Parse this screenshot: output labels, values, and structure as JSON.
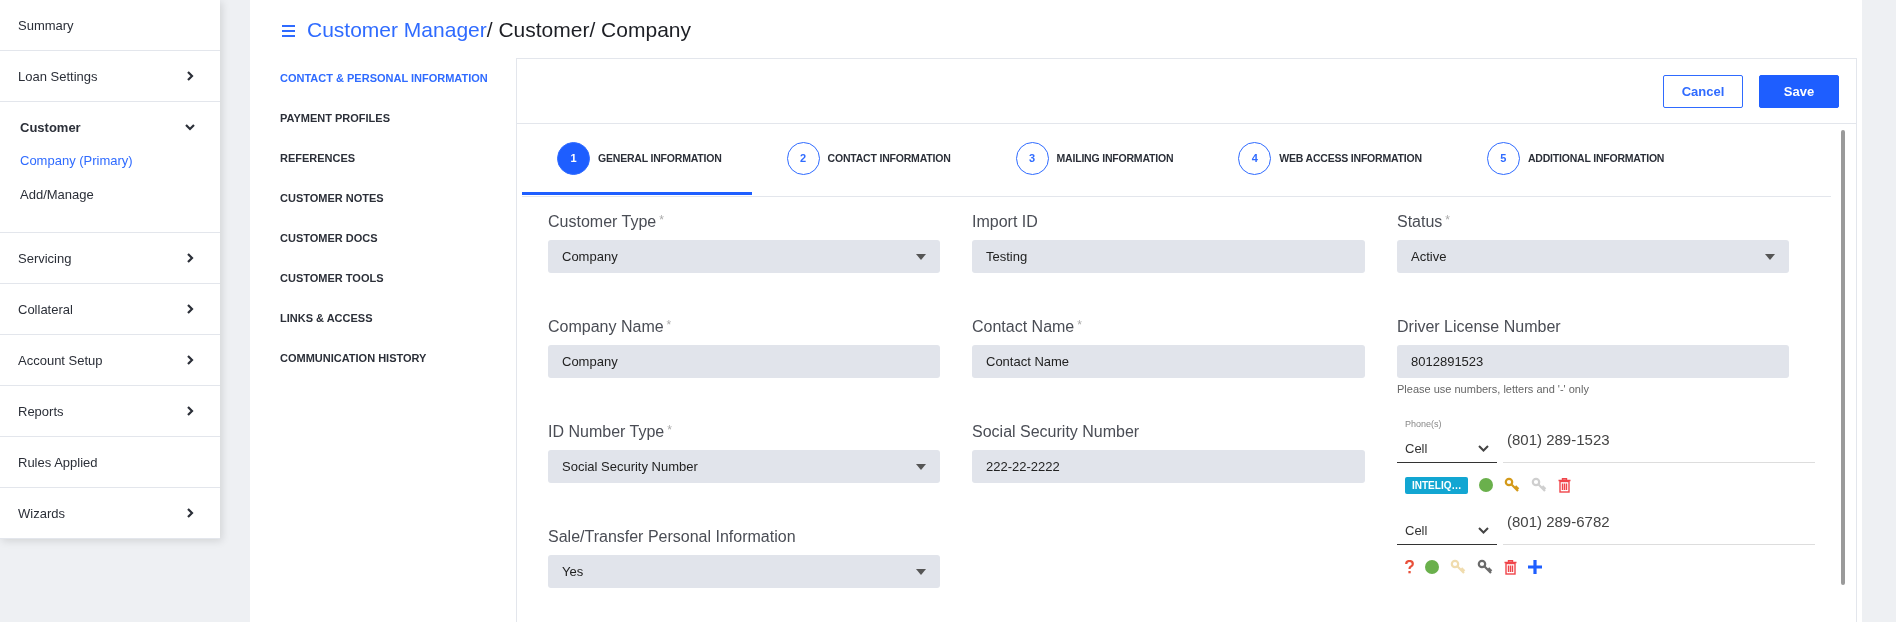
{
  "sidebar": {
    "items": [
      {
        "label": "Summary"
      },
      {
        "label": "Loan Settings",
        "expanded": false
      },
      {
        "label": "Customer",
        "expanded": true,
        "children": [
          {
            "label": "Company (Primary)",
            "selected": true
          },
          {
            "label": "Add/Manage",
            "selected": false
          }
        ]
      },
      {
        "label": "Servicing",
        "expanded": false
      },
      {
        "label": "Collateral",
        "expanded": false
      },
      {
        "label": "Account Setup",
        "expanded": false
      },
      {
        "label": "Reports",
        "expanded": false
      },
      {
        "label": "Rules Applied"
      },
      {
        "label": "Wizards",
        "expanded": false
      }
    ]
  },
  "breadcrumb": [
    {
      "text": "Customer Manager",
      "link": true
    },
    {
      "text": "/ Customer",
      "link": false
    },
    {
      "text": "/ Company",
      "link": false
    }
  ],
  "section_nav": [
    {
      "label": "CONTACT & PERSONAL INFORMATION",
      "selected": true
    },
    {
      "label": "PAYMENT PROFILES",
      "selected": false
    },
    {
      "label": "REFERENCES",
      "selected": false
    },
    {
      "label": "CUSTOMER NOTES",
      "selected": false
    },
    {
      "label": "CUSTOMER DOCS",
      "selected": false
    },
    {
      "label": "CUSTOMER TOOLS",
      "selected": false
    },
    {
      "label": "LINKS & ACCESS",
      "selected": false
    },
    {
      "label": "COMMUNICATION HISTORY",
      "selected": false
    }
  ],
  "buttons": {
    "cancel": "Cancel",
    "save": "Save"
  },
  "tabs": [
    {
      "number": "1",
      "label": "GENERAL INFORMATION",
      "selected": true
    },
    {
      "number": "2",
      "label": "CONTACT INFORMATION",
      "selected": false
    },
    {
      "number": "3",
      "label": "MAILING INFORMATION",
      "selected": false
    },
    {
      "number": "4",
      "label": "WEB ACCESS INFORMATION",
      "selected": false
    },
    {
      "number": "5",
      "label": "ADDITIONAL INFORMATION",
      "selected": false
    }
  ],
  "form": {
    "columns": [
      [
        {
          "label": "Customer Type",
          "required_mark": "*",
          "kind": "select",
          "value": "Company"
        },
        {
          "label": "Company Name",
          "required_mark": "*",
          "kind": "text",
          "value": "Company"
        },
        {
          "label": "ID Number Type",
          "required_mark": "*",
          "kind": "select",
          "value": "Social Security Number"
        },
        {
          "label": "Sale/Transfer Personal Information",
          "kind": "select",
          "value": "Yes"
        }
      ],
      [
        {
          "label": "Import ID",
          "kind": "text",
          "value": "Testing"
        },
        {
          "label": "Contact Name",
          "required_mark": "*",
          "kind": "text",
          "value": "Contact Name"
        },
        {
          "label": "Social Security Number",
          "kind": "text",
          "value": "222-22-2222"
        }
      ],
      [
        {
          "label": "Status",
          "required_mark": "*",
          "kind": "select",
          "value": "Active"
        },
        {
          "label": "Driver License Number",
          "kind": "text",
          "value": "8012891523",
          "helper": "Please use numbers, letters and '-' only"
        }
      ]
    ]
  },
  "phones": {
    "label": "Phone(s)",
    "entries": [
      {
        "type": "Cell",
        "number": "(801) 289-1523",
        "actions": [
          {
            "kind": "badge",
            "text": "INTELIQ…"
          },
          {
            "kind": "dot",
            "color": "#6ab04c"
          },
          {
            "kind": "key",
            "color": "#d49a1a"
          },
          {
            "kind": "key",
            "color": "#cfcfcf"
          },
          {
            "kind": "trash"
          }
        ]
      },
      {
        "type": "Cell",
        "number": "(801) 289-6782",
        "actions": [
          {
            "kind": "question"
          },
          {
            "kind": "dot",
            "color": "#6ab04c"
          },
          {
            "kind": "key",
            "color": "#f0dcae"
          },
          {
            "kind": "key",
            "color": "#6b6b6b"
          },
          {
            "kind": "trash"
          },
          {
            "kind": "plus"
          }
        ]
      }
    ]
  }
}
